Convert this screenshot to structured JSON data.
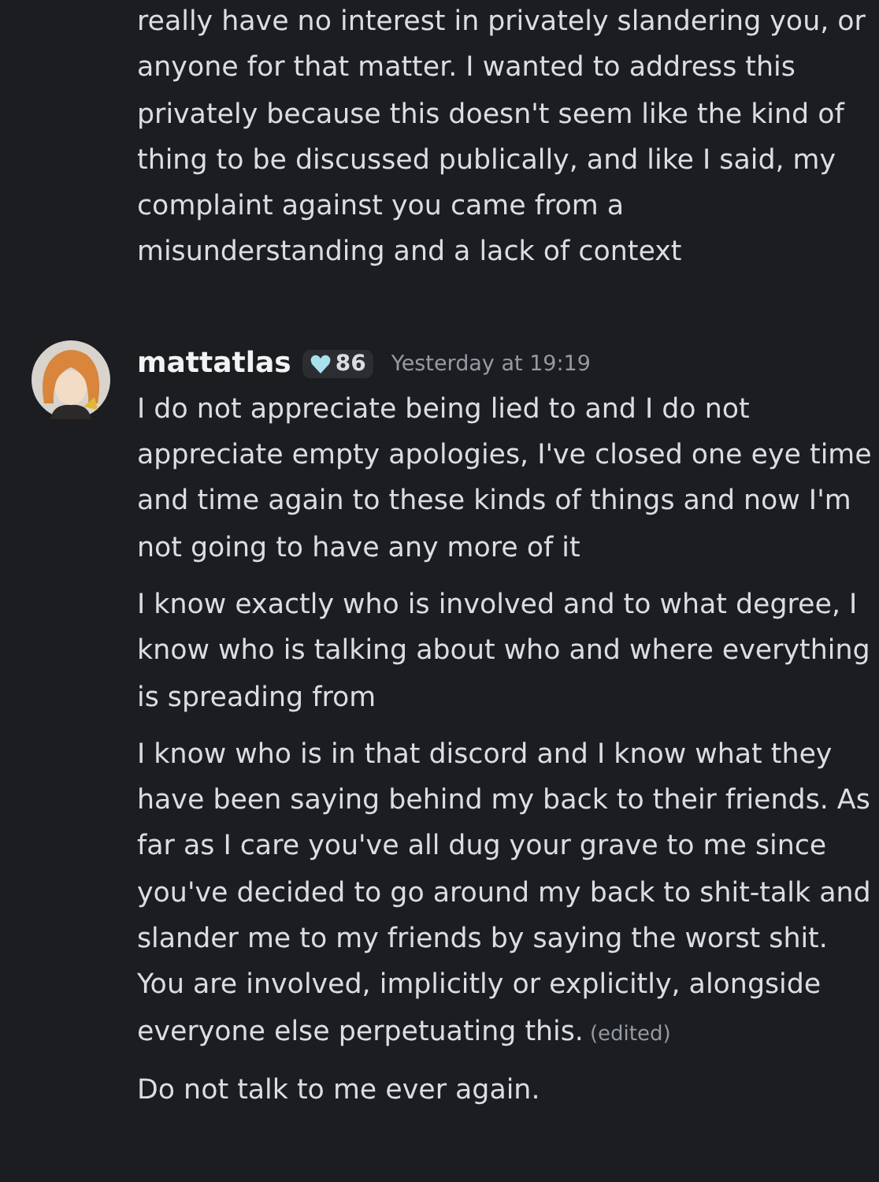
{
  "previous_message": {
    "text": "really have no interest in privately slandering you, or anyone for that matter. I wanted to address this privately because this doesn't seem like the kind of thing to be discussed publically, and like I said, my complaint against you came from a misunderstanding and a lack of context"
  },
  "message": {
    "author": "mattatlas",
    "badge": "86",
    "timestamp": "Yesterday at 19:19",
    "paragraphs": [
      {
        "text": "I do not appreciate being lied to and I do not appreciate empty apologies, I've closed one eye time and time again to these kinds of things and now I'm not going to have any more of it"
      },
      {
        "text": "I know exactly who is involved and to what degree, I know who is talking about who and where everything is spreading from"
      },
      {
        "text": "I know who is in that discord and I know what they have been saying behind my back to their friends. As far as I care you've all dug your grave to me since you've decided to go around my back to shit-talk and slander me to my friends by saying the worst shit. You are involved, implicitly or explicitly, alongside everyone else perpetuating this.",
        "edited": "(edited)"
      },
      {
        "text": "Do not talk to me ever again."
      }
    ]
  }
}
